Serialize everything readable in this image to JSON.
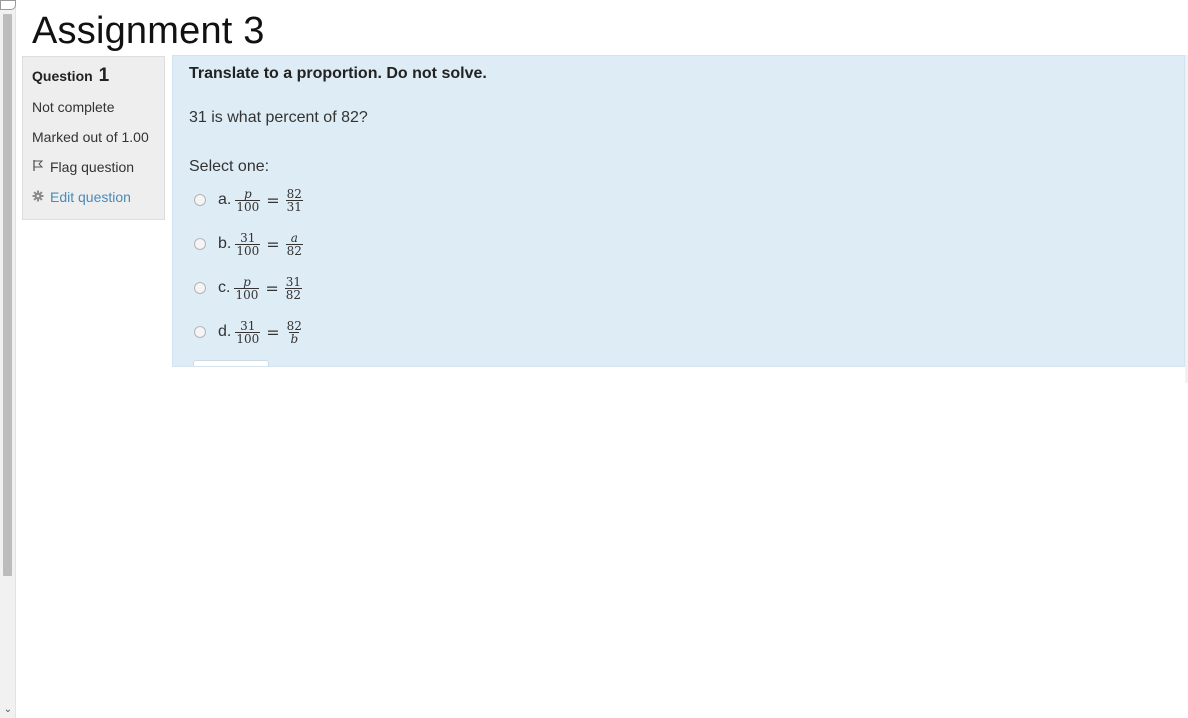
{
  "page": {
    "title": "Assignment 3"
  },
  "question": {
    "label": "Question",
    "number": "1",
    "state": "Not complete",
    "grade": "Marked out of 1.00",
    "flag_label": "Flag question",
    "edit_label": "Edit question",
    "instruction": "Translate to a proportion. Do not solve.",
    "text": "31 is what percent of 82?",
    "prompt": "Select one:",
    "answers": [
      {
        "letter": "a.",
        "left_num": "p",
        "left_den": "100",
        "right_num": "82",
        "right_den": "31"
      },
      {
        "letter": "b.",
        "left_num": "31",
        "left_den": "100",
        "right_num": "a",
        "right_den": "82"
      },
      {
        "letter": "c.",
        "left_num": "p",
        "left_den": "100",
        "right_num": "31",
        "right_den": "82"
      },
      {
        "letter": "d.",
        "left_num": "31",
        "left_den": "100",
        "right_num": "82",
        "right_den": "b"
      }
    ],
    "equals": "="
  },
  "icons": {
    "flag": "flag-icon",
    "edit": "gear-icon",
    "scroll_down": "chevron-down-icon"
  },
  "colors": {
    "content_bg": "#deecf5",
    "info_bg": "#eeeeee",
    "link": "#4a8bb7"
  }
}
